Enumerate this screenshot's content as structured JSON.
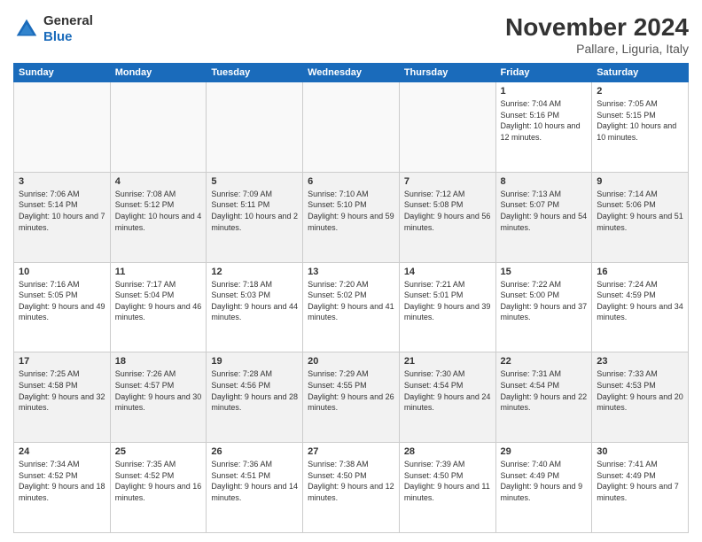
{
  "header": {
    "logo_general": "General",
    "logo_blue": "Blue",
    "month_year": "November 2024",
    "location": "Pallare, Liguria, Italy"
  },
  "weekdays": [
    "Sunday",
    "Monday",
    "Tuesday",
    "Wednesday",
    "Thursday",
    "Friday",
    "Saturday"
  ],
  "weeks": [
    [
      {
        "day": "",
        "info": ""
      },
      {
        "day": "",
        "info": ""
      },
      {
        "day": "",
        "info": ""
      },
      {
        "day": "",
        "info": ""
      },
      {
        "day": "",
        "info": ""
      },
      {
        "day": "1",
        "info": "Sunrise: 7:04 AM\nSunset: 5:16 PM\nDaylight: 10 hours and 12 minutes."
      },
      {
        "day": "2",
        "info": "Sunrise: 7:05 AM\nSunset: 5:15 PM\nDaylight: 10 hours and 10 minutes."
      }
    ],
    [
      {
        "day": "3",
        "info": "Sunrise: 7:06 AM\nSunset: 5:14 PM\nDaylight: 10 hours and 7 minutes."
      },
      {
        "day": "4",
        "info": "Sunrise: 7:08 AM\nSunset: 5:12 PM\nDaylight: 10 hours and 4 minutes."
      },
      {
        "day": "5",
        "info": "Sunrise: 7:09 AM\nSunset: 5:11 PM\nDaylight: 10 hours and 2 minutes."
      },
      {
        "day": "6",
        "info": "Sunrise: 7:10 AM\nSunset: 5:10 PM\nDaylight: 9 hours and 59 minutes."
      },
      {
        "day": "7",
        "info": "Sunrise: 7:12 AM\nSunset: 5:08 PM\nDaylight: 9 hours and 56 minutes."
      },
      {
        "day": "8",
        "info": "Sunrise: 7:13 AM\nSunset: 5:07 PM\nDaylight: 9 hours and 54 minutes."
      },
      {
        "day": "9",
        "info": "Sunrise: 7:14 AM\nSunset: 5:06 PM\nDaylight: 9 hours and 51 minutes."
      }
    ],
    [
      {
        "day": "10",
        "info": "Sunrise: 7:16 AM\nSunset: 5:05 PM\nDaylight: 9 hours and 49 minutes."
      },
      {
        "day": "11",
        "info": "Sunrise: 7:17 AM\nSunset: 5:04 PM\nDaylight: 9 hours and 46 minutes."
      },
      {
        "day": "12",
        "info": "Sunrise: 7:18 AM\nSunset: 5:03 PM\nDaylight: 9 hours and 44 minutes."
      },
      {
        "day": "13",
        "info": "Sunrise: 7:20 AM\nSunset: 5:02 PM\nDaylight: 9 hours and 41 minutes."
      },
      {
        "day": "14",
        "info": "Sunrise: 7:21 AM\nSunset: 5:01 PM\nDaylight: 9 hours and 39 minutes."
      },
      {
        "day": "15",
        "info": "Sunrise: 7:22 AM\nSunset: 5:00 PM\nDaylight: 9 hours and 37 minutes."
      },
      {
        "day": "16",
        "info": "Sunrise: 7:24 AM\nSunset: 4:59 PM\nDaylight: 9 hours and 34 minutes."
      }
    ],
    [
      {
        "day": "17",
        "info": "Sunrise: 7:25 AM\nSunset: 4:58 PM\nDaylight: 9 hours and 32 minutes."
      },
      {
        "day": "18",
        "info": "Sunrise: 7:26 AM\nSunset: 4:57 PM\nDaylight: 9 hours and 30 minutes."
      },
      {
        "day": "19",
        "info": "Sunrise: 7:28 AM\nSunset: 4:56 PM\nDaylight: 9 hours and 28 minutes."
      },
      {
        "day": "20",
        "info": "Sunrise: 7:29 AM\nSunset: 4:55 PM\nDaylight: 9 hours and 26 minutes."
      },
      {
        "day": "21",
        "info": "Sunrise: 7:30 AM\nSunset: 4:54 PM\nDaylight: 9 hours and 24 minutes."
      },
      {
        "day": "22",
        "info": "Sunrise: 7:31 AM\nSunset: 4:54 PM\nDaylight: 9 hours and 22 minutes."
      },
      {
        "day": "23",
        "info": "Sunrise: 7:33 AM\nSunset: 4:53 PM\nDaylight: 9 hours and 20 minutes."
      }
    ],
    [
      {
        "day": "24",
        "info": "Sunrise: 7:34 AM\nSunset: 4:52 PM\nDaylight: 9 hours and 18 minutes."
      },
      {
        "day": "25",
        "info": "Sunrise: 7:35 AM\nSunset: 4:52 PM\nDaylight: 9 hours and 16 minutes."
      },
      {
        "day": "26",
        "info": "Sunrise: 7:36 AM\nSunset: 4:51 PM\nDaylight: 9 hours and 14 minutes."
      },
      {
        "day": "27",
        "info": "Sunrise: 7:38 AM\nSunset: 4:50 PM\nDaylight: 9 hours and 12 minutes."
      },
      {
        "day": "28",
        "info": "Sunrise: 7:39 AM\nSunset: 4:50 PM\nDaylight: 9 hours and 11 minutes."
      },
      {
        "day": "29",
        "info": "Sunrise: 7:40 AM\nSunset: 4:49 PM\nDaylight: 9 hours and 9 minutes."
      },
      {
        "day": "30",
        "info": "Sunrise: 7:41 AM\nSunset: 4:49 PM\nDaylight: 9 hours and 7 minutes."
      }
    ]
  ]
}
